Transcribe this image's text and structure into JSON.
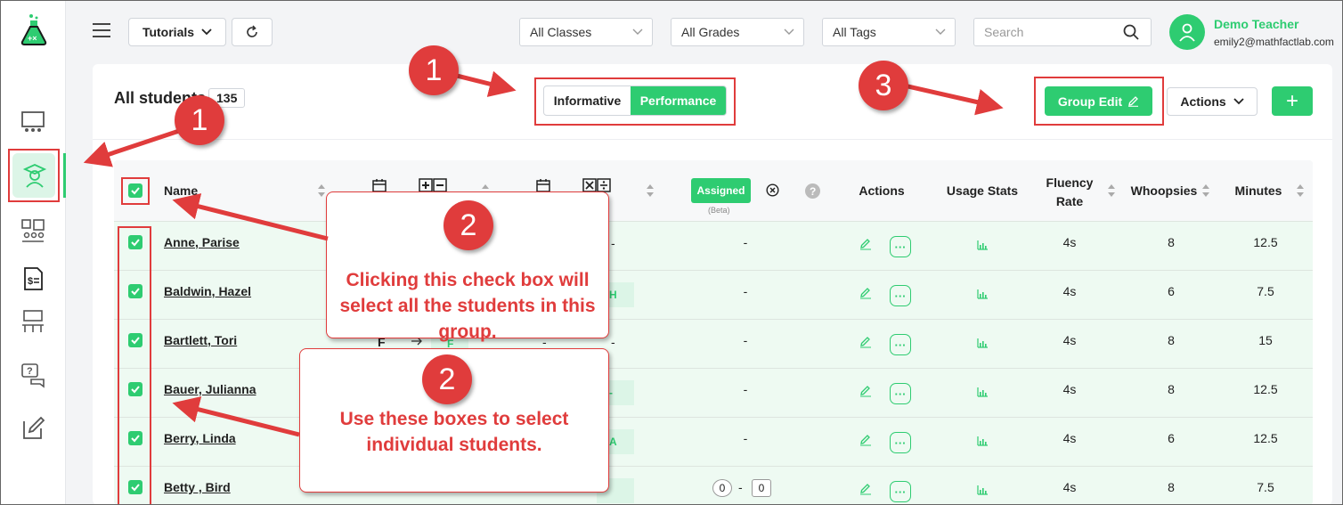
{
  "topbar": {
    "tutorials_label": "Tutorials",
    "filters": [
      "All Classes",
      "All Grades",
      "All Tags"
    ],
    "search_placeholder": "Search",
    "user_name": "Demo Teacher",
    "user_email": "emily2@mathfactlab.com"
  },
  "header": {
    "title": "All students",
    "count": "135",
    "toggle": {
      "informative": "Informative",
      "performance": "Performance"
    },
    "group_edit": "Group Edit",
    "actions": "Actions",
    "add": "+"
  },
  "table": {
    "columns": {
      "name": "Name",
      "assigned": "Assigned",
      "beta": "(Beta)",
      "actions": "Actions",
      "usage_stats": "Usage Stats",
      "fluency_rate": "Fluency Rate",
      "whoopsies": "Whoopsies",
      "minutes": "Minutes"
    },
    "rows": [
      {
        "name": "Anne, Parise",
        "assigned": "-",
        "fluency": "4s",
        "whoopsies": "8",
        "minutes": "12.5"
      },
      {
        "name": "Baldwin, Hazel",
        "assigned": "-",
        "fluency": "4s",
        "whoopsies": "6",
        "minutes": "7.5"
      },
      {
        "name": "Bartlett, Tori",
        "assigned": "-",
        "fluency": "4s",
        "whoopsies": "8",
        "minutes": "15"
      },
      {
        "name": "Bauer, Julianna",
        "assigned": "-",
        "fluency": "4s",
        "whoopsies": "8",
        "minutes": "12.5"
      },
      {
        "name": "Berry, Linda",
        "assigned": "-",
        "fluency": "4s",
        "whoopsies": "6",
        "minutes": "12.5"
      },
      {
        "name": "Betty , Bird",
        "assigned": "-",
        "fluency": "4s",
        "whoopsies": "8",
        "minutes": "7.5"
      }
    ],
    "partial": {
      "row1_dash": "-",
      "row2_tag": "H",
      "row3_col_f": "F",
      "row3_tag": "F",
      "row3_dash_a": "-",
      "row3_dash_b": "-",
      "row4_tag": "-",
      "row5_tag": "A",
      "row6_zero_a": "0",
      "row6_zero_b": "0",
      "row6_dash": "-"
    }
  },
  "annotations": {
    "marker_1": "1",
    "marker_2": "2",
    "marker_3": "3",
    "callout_select_all": "Clicking this check box will select all the students in this group.",
    "callout_select_individual": "Use these boxes to select individual students.",
    "annotation_color": "#e03c3c"
  },
  "colors": {
    "accent": "#2ecc71"
  }
}
